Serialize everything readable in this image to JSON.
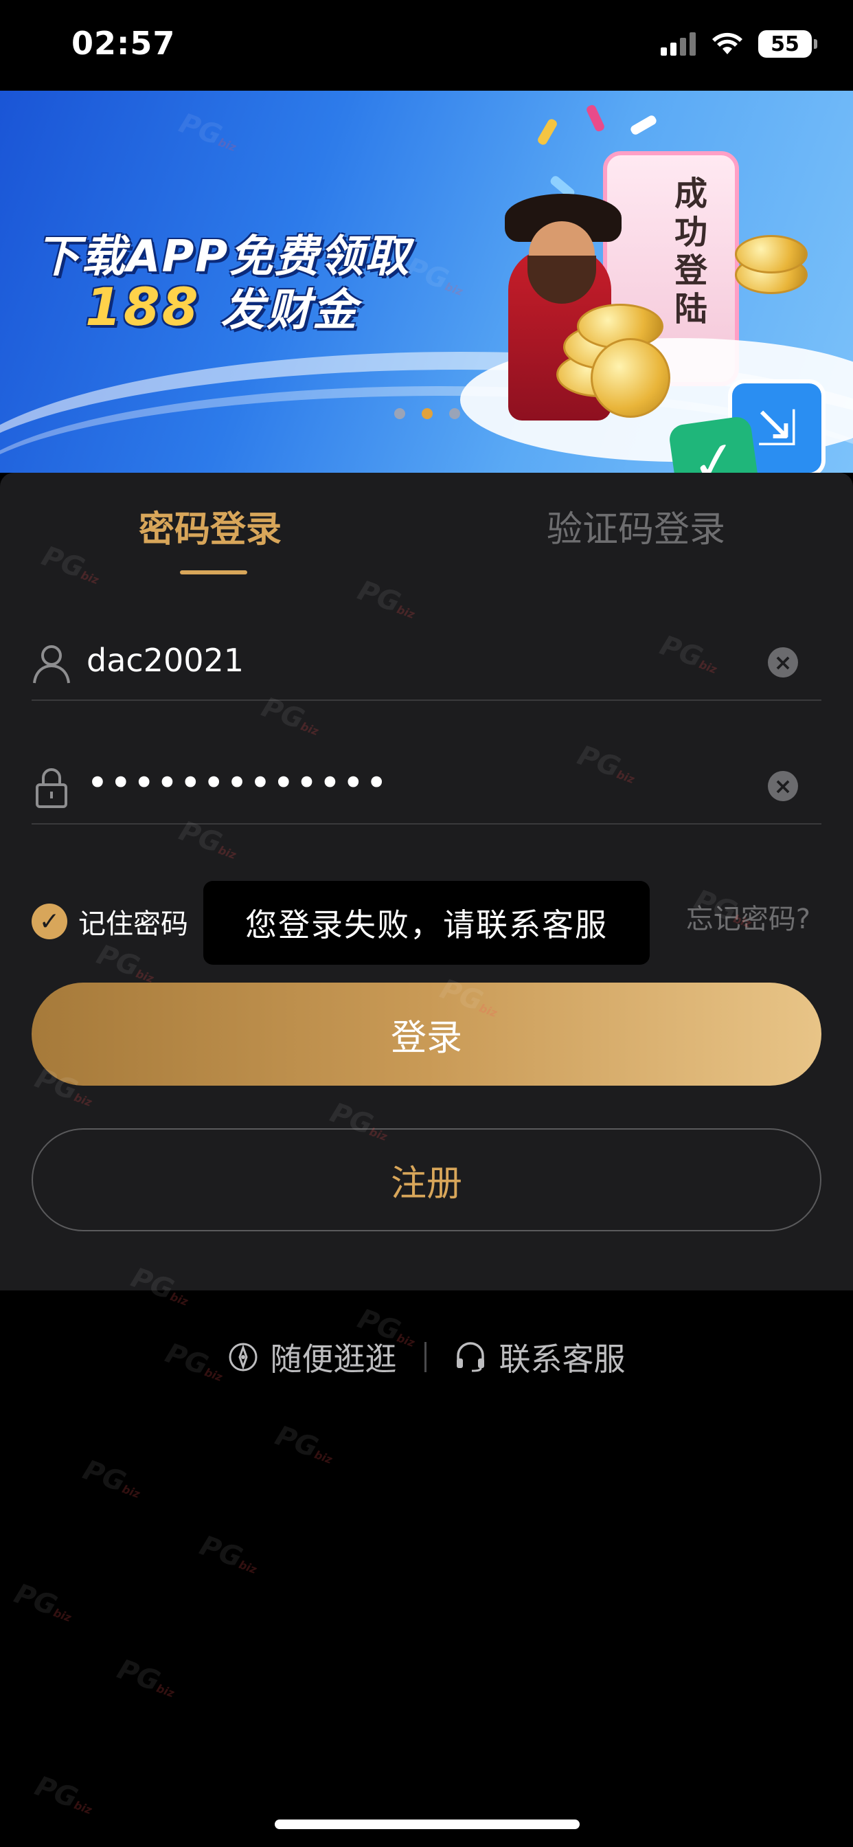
{
  "status_bar": {
    "time": "02:57",
    "battery": "55"
  },
  "banner": {
    "headline_line1": "下载APP免费领取",
    "headline_amount": "188",
    "headline_suffix": "发财金",
    "card_text": "成功登陆",
    "carousel": {
      "count": 3,
      "active_index": 1
    }
  },
  "tabs": [
    {
      "label": "密码登录",
      "active": true
    },
    {
      "label": "验证码登录",
      "active": false
    }
  ],
  "form": {
    "username_value": "dac20021",
    "password_value": "•••••••••••••",
    "remember_label": "记住密码",
    "remember_checked": true,
    "forgot_label": "忘记密码?",
    "login_label": "登录",
    "register_label": "注册"
  },
  "toast": {
    "message": "您登录失败，请联系客服"
  },
  "footer": {
    "browse_label": "随便逛逛",
    "support_label": "联系客服"
  },
  "watermark": {
    "text": "PG",
    "sub": "biz"
  },
  "colors": {
    "accent_gold": "#d8a65a",
    "panel_bg": "#1c1c1e",
    "page_bg": "#000000"
  }
}
